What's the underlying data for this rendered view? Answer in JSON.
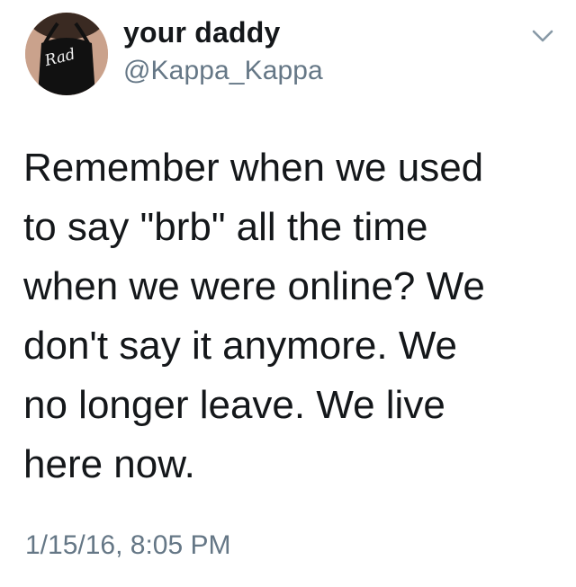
{
  "user": {
    "display_name": "your daddy",
    "handle": "@Kappa_Kappa",
    "avatar_text": "Rad"
  },
  "tweet": {
    "text": "Remember when we used\nto say \"brb\" all the time\nwhen we were online? We\ndon't say it anymore. We\nno longer leave. We live\nhere now.",
    "timestamp": "1/15/16, 8:05 PM"
  },
  "icons": {
    "menu": "chevron-down-icon"
  },
  "colors": {
    "text": "#14171a",
    "secondary": "#657786",
    "background": "#ffffff"
  }
}
